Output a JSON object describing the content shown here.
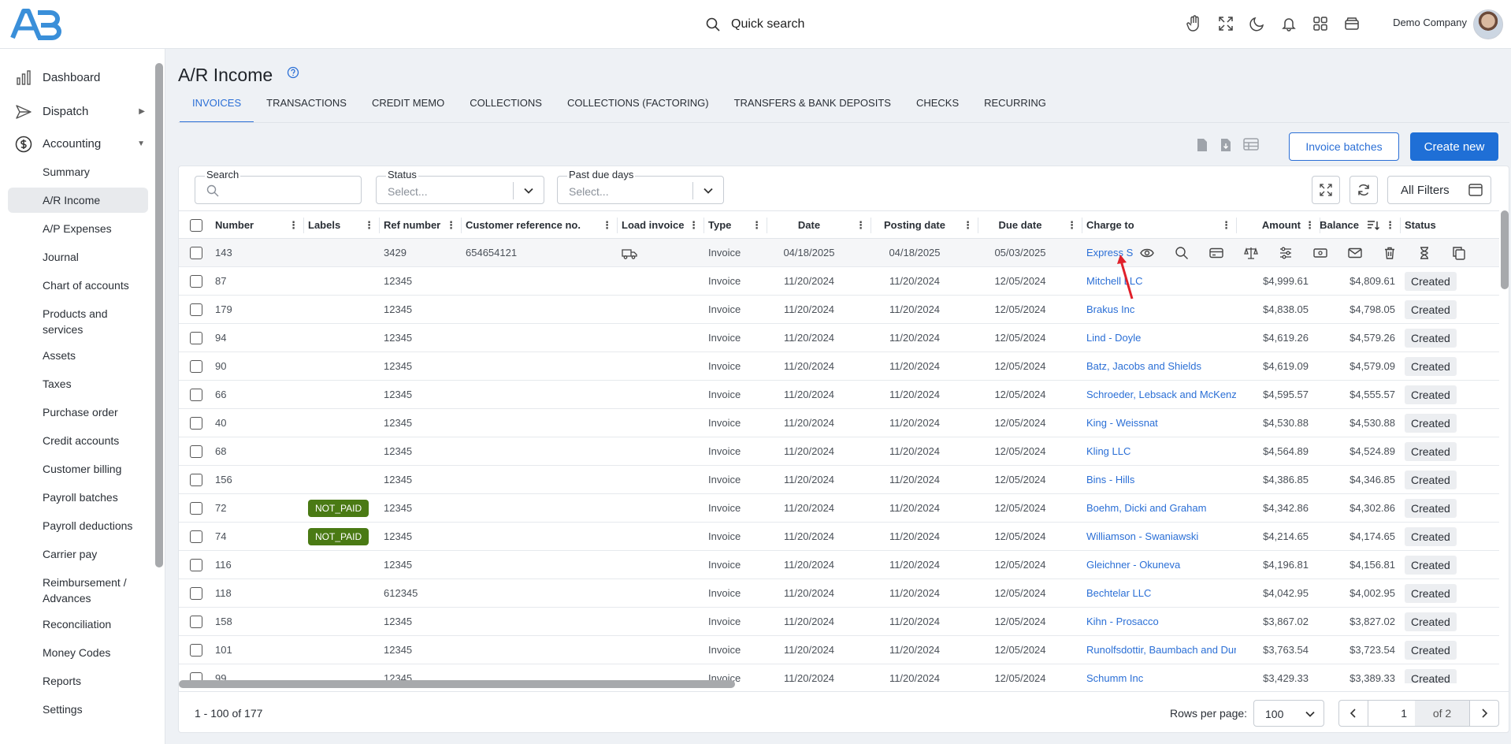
{
  "header": {
    "logo_text": "AB",
    "quick_search": "Quick search",
    "company": "Demo Company",
    "icons": [
      "hand-icon",
      "fullscreen-icon",
      "moon-icon",
      "bell-icon",
      "apps-grid-icon",
      "wallet-icon"
    ]
  },
  "sidebar": {
    "top_items": [
      {
        "label": "Dashboard",
        "icon": "dashboard-icon"
      },
      {
        "label": "Dispatch",
        "icon": "dispatch-icon",
        "arrow": "▶"
      },
      {
        "label": "Accounting",
        "icon": "dollar-icon",
        "arrow": "▼"
      }
    ],
    "sub_items": [
      "Summary",
      "A/R Income",
      "A/P Expenses",
      "Journal",
      "Chart of accounts",
      "Products and services",
      "Assets",
      "Taxes",
      "Purchase order",
      "Credit accounts",
      "Customer billing",
      "Payroll batches",
      "Payroll deductions",
      "Carrier pay",
      "Reimbursement / Advances",
      "Reconciliation",
      "Money Codes",
      "Reports",
      "Settings"
    ],
    "active": "A/R Income"
  },
  "page": {
    "title": "A/R Income",
    "tabs": [
      "INVOICES",
      "TRANSACTIONS",
      "CREDIT MEMO",
      "COLLECTIONS",
      "COLLECTIONS (FACTORING)",
      "TRANSFERS & BANK DEPOSITS",
      "CHECKS",
      "RECURRING"
    ],
    "active_tab": "INVOICES",
    "invoice_batches": "Invoice batches",
    "create_new": "Create new"
  },
  "filters": {
    "search_label": "Search",
    "status_label": "Status",
    "status_placeholder": "Select...",
    "past_due_label": "Past due days",
    "past_due_placeholder": "Select...",
    "all_filters": "All Filters"
  },
  "table": {
    "columns": [
      "Number",
      "Labels",
      "Ref number",
      "Customer reference no.",
      "Load invoice",
      "Type",
      "Date",
      "Posting date",
      "Due date",
      "Charge to",
      "Amount",
      "Balance",
      "Status"
    ],
    "rows": [
      {
        "number": "143",
        "label": "",
        "ref": "3429",
        "cust_ref": "654654121",
        "load": true,
        "type": "Invoice",
        "date": "04/18/2025",
        "posting": "04/18/2025",
        "due": "05/03/2025",
        "charge_to": "Express S",
        "amount": "",
        "balance": "",
        "status": ""
      },
      {
        "number": "87",
        "label": "",
        "ref": "12345",
        "cust_ref": "",
        "load": false,
        "type": "Invoice",
        "date": "11/20/2024",
        "posting": "11/20/2024",
        "due": "12/05/2024",
        "charge_to": "Mitchell LLC",
        "amount": "$4,999.61",
        "balance": "$4,809.61",
        "status": "Created"
      },
      {
        "number": "179",
        "label": "",
        "ref": "12345",
        "cust_ref": "",
        "load": false,
        "type": "Invoice",
        "date": "11/20/2024",
        "posting": "11/20/2024",
        "due": "12/05/2024",
        "charge_to": "Brakus Inc",
        "amount": "$4,838.05",
        "balance": "$4,798.05",
        "status": "Created"
      },
      {
        "number": "94",
        "label": "",
        "ref": "12345",
        "cust_ref": "",
        "load": false,
        "type": "Invoice",
        "date": "11/20/2024",
        "posting": "11/20/2024",
        "due": "12/05/2024",
        "charge_to": "Lind - Doyle",
        "amount": "$4,619.26",
        "balance": "$4,579.26",
        "status": "Created"
      },
      {
        "number": "90",
        "label": "",
        "ref": "12345",
        "cust_ref": "",
        "load": false,
        "type": "Invoice",
        "date": "11/20/2024",
        "posting": "11/20/2024",
        "due": "12/05/2024",
        "charge_to": "Batz, Jacobs and Shields",
        "amount": "$4,619.09",
        "balance": "$4,579.09",
        "status": "Created"
      },
      {
        "number": "66",
        "label": "",
        "ref": "12345",
        "cust_ref": "",
        "load": false,
        "type": "Invoice",
        "date": "11/20/2024",
        "posting": "11/20/2024",
        "due": "12/05/2024",
        "charge_to": "Schroeder, Lebsack and McKenzie",
        "amount": "$4,595.57",
        "balance": "$4,555.57",
        "status": "Created"
      },
      {
        "number": "40",
        "label": "",
        "ref": "12345",
        "cust_ref": "",
        "load": false,
        "type": "Invoice",
        "date": "11/20/2024",
        "posting": "11/20/2024",
        "due": "12/05/2024",
        "charge_to": "King - Weissnat",
        "amount": "$4,530.88",
        "balance": "$4,530.88",
        "status": "Created"
      },
      {
        "number": "68",
        "label": "",
        "ref": "12345",
        "cust_ref": "",
        "load": false,
        "type": "Invoice",
        "date": "11/20/2024",
        "posting": "11/20/2024",
        "due": "12/05/2024",
        "charge_to": "Kling LLC",
        "amount": "$4,564.89",
        "balance": "$4,524.89",
        "status": "Created"
      },
      {
        "number": "156",
        "label": "",
        "ref": "12345",
        "cust_ref": "",
        "load": false,
        "type": "Invoice",
        "date": "11/20/2024",
        "posting": "11/20/2024",
        "due": "12/05/2024",
        "charge_to": "Bins - Hills",
        "amount": "$4,386.85",
        "balance": "$4,346.85",
        "status": "Created"
      },
      {
        "number": "72",
        "label": "NOT_PAID",
        "ref": "12345",
        "cust_ref": "",
        "load": false,
        "type": "Invoice",
        "date": "11/20/2024",
        "posting": "11/20/2024",
        "due": "12/05/2024",
        "charge_to": "Boehm, Dicki and Graham",
        "amount": "$4,342.86",
        "balance": "$4,302.86",
        "status": "Created"
      },
      {
        "number": "74",
        "label": "NOT_PAID",
        "ref": "12345",
        "cust_ref": "",
        "load": false,
        "type": "Invoice",
        "date": "11/20/2024",
        "posting": "11/20/2024",
        "due": "12/05/2024",
        "charge_to": "Williamson - Swaniawski",
        "amount": "$4,214.65",
        "balance": "$4,174.65",
        "status": "Created"
      },
      {
        "number": "116",
        "label": "",
        "ref": "12345",
        "cust_ref": "",
        "load": false,
        "type": "Invoice",
        "date": "11/20/2024",
        "posting": "11/20/2024",
        "due": "12/05/2024",
        "charge_to": "Gleichner - Okuneva",
        "amount": "$4,196.81",
        "balance": "$4,156.81",
        "status": "Created"
      },
      {
        "number": "118",
        "label": "",
        "ref": "612345",
        "cust_ref": "",
        "load": false,
        "type": "Invoice",
        "date": "11/20/2024",
        "posting": "11/20/2024",
        "due": "12/05/2024",
        "charge_to": "Bechtelar LLC",
        "amount": "$4,042.95",
        "balance": "$4,002.95",
        "status": "Created"
      },
      {
        "number": "158",
        "label": "",
        "ref": "12345",
        "cust_ref": "",
        "load": false,
        "type": "Invoice",
        "date": "11/20/2024",
        "posting": "11/20/2024",
        "due": "12/05/2024",
        "charge_to": "Kihn - Prosacco",
        "amount": "$3,867.02",
        "balance": "$3,827.02",
        "status": "Created"
      },
      {
        "number": "101",
        "label": "",
        "ref": "12345",
        "cust_ref": "",
        "load": false,
        "type": "Invoice",
        "date": "11/20/2024",
        "posting": "11/20/2024",
        "due": "12/05/2024",
        "charge_to": "Runolfsdottir, Baumbach and Dur",
        "amount": "$3,763.54",
        "balance": "$3,723.54",
        "status": "Created"
      },
      {
        "number": "99",
        "label": "",
        "ref": "12345",
        "cust_ref": "",
        "load": false,
        "type": "Invoice",
        "date": "11/20/2024",
        "posting": "11/20/2024",
        "due": "12/05/2024",
        "charge_to": "Schumm Inc",
        "amount": "$3,429.33",
        "balance": "$3,389.33",
        "status": "Created"
      }
    ],
    "row_action_icons": [
      "eye-icon",
      "search-icon",
      "card-icon",
      "scale-icon",
      "sliders-icon",
      "money-icon",
      "mail-icon",
      "trash-icon",
      "hourglass-icon",
      "copy-icon"
    ]
  },
  "footer": {
    "range": "1 - 100 of 177",
    "rows_per_page_label": "Rows per page:",
    "rows_per_page": "100",
    "page": "1",
    "of_pages": "of 2"
  },
  "colors": {
    "accent": "#2b6fd6",
    "badge_green": "#4a7a14",
    "annotation_arrow": "#e0202a"
  }
}
